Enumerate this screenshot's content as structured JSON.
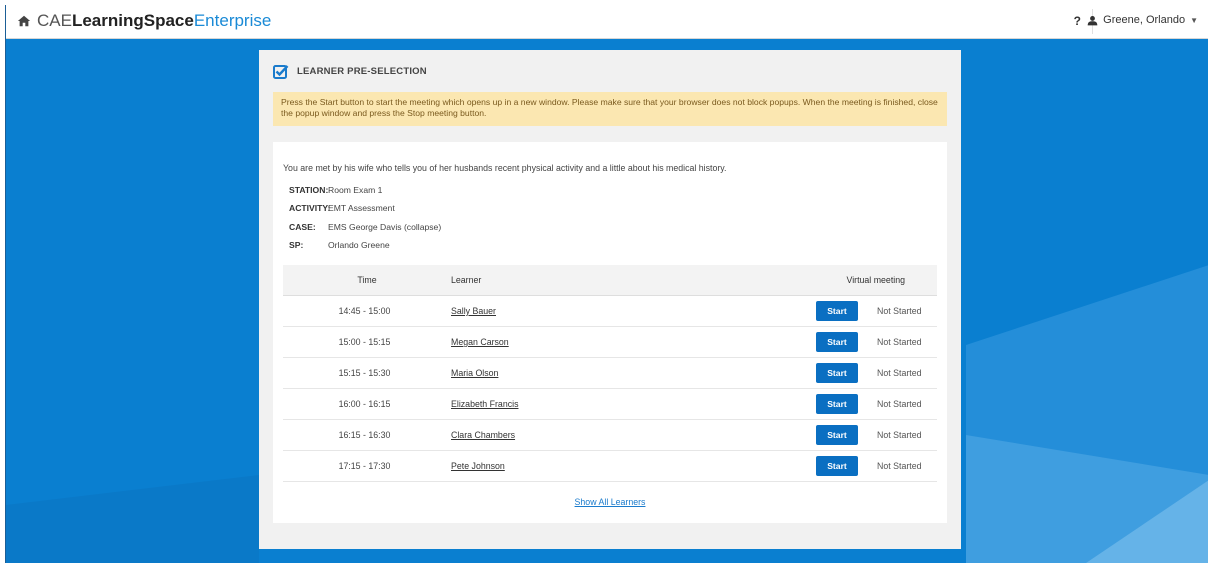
{
  "app": {
    "brand_prefix": "CAE",
    "brand_main": "LearningSpace",
    "brand_suffix": "Enterprise",
    "help_label": "?",
    "user_name": "Greene, Orlando",
    "accent": "#0a7fd0"
  },
  "panel": {
    "title": "LEARNER PRE-SELECTION",
    "notice": "Press the Start button to start the meeting which opens up in a new window. Please make sure that your browser does not block popups. When the meeting is finished, close the popup window and press the Stop meeting button.",
    "intro": "You are met by his wife who tells you of her husbands recent physical activity and a little about his medical history.",
    "details": [
      {
        "key": "STATION:",
        "value": "Room Exam 1"
      },
      {
        "key": "ACTIVITY:",
        "value": "EMT Assessment"
      },
      {
        "key": "CASE:",
        "value": "EMS George Davis (collapse)"
      },
      {
        "key": "SP:",
        "value": "Orlando Greene"
      }
    ]
  },
  "table": {
    "headers": {
      "time": "Time",
      "learner": "Learner",
      "virtual_meeting": "Virtual meeting"
    },
    "rows": [
      {
        "time": "14:45 - 15:00",
        "learner": "Sally Bauer",
        "button": "Start",
        "status": "Not Started"
      },
      {
        "time": "15:00 - 15:15",
        "learner": "Megan Carson",
        "button": "Start",
        "status": "Not Started"
      },
      {
        "time": "15:15 - 15:30",
        "learner": "Maria Olson",
        "button": "Start",
        "status": "Not Started"
      },
      {
        "time": "16:00 - 16:15",
        "learner": "Elizabeth Francis",
        "button": "Start",
        "status": "Not Started"
      },
      {
        "time": "16:15 - 16:30",
        "learner": "Clara Chambers",
        "button": "Start",
        "status": "Not Started"
      },
      {
        "time": "17:15 - 17:30",
        "learner": "Pete Johnson",
        "button": "Start",
        "status": "Not Started"
      }
    ],
    "show_all": "Show All Learners"
  }
}
